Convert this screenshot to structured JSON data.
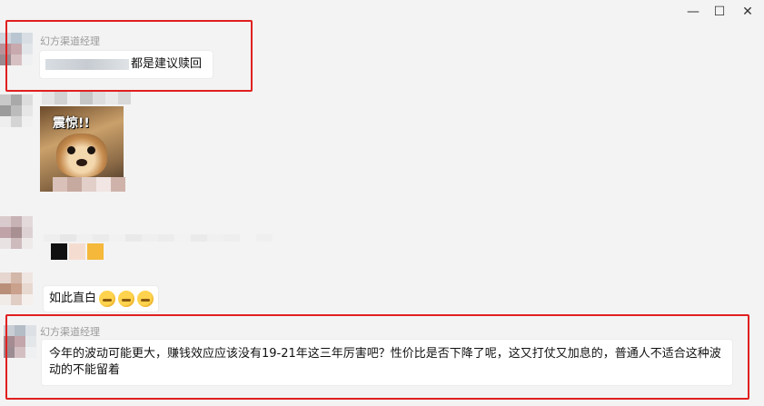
{
  "window": {
    "controls": {
      "minimize": "—",
      "maximize": "☐",
      "close": "✕"
    }
  },
  "messages": [
    {
      "sender": "幻方渠道经理",
      "text": "都是建议赎回"
    },
    {
      "sticker_caption": "震惊!!"
    },
    {
      "text": "如此直白"
    },
    {
      "sender": "幻方渠道经理",
      "text": "今年的波动可能更大，赚钱效应应该没有19-21年这三年厉害吧？性价比是否下降了呢，这又打仗又加息的，普通人不适合这种波动的不能留着"
    }
  ],
  "colors": {
    "highlight": "#e0201f",
    "background": "#f3f3f3",
    "bubble": "#ffffff"
  }
}
